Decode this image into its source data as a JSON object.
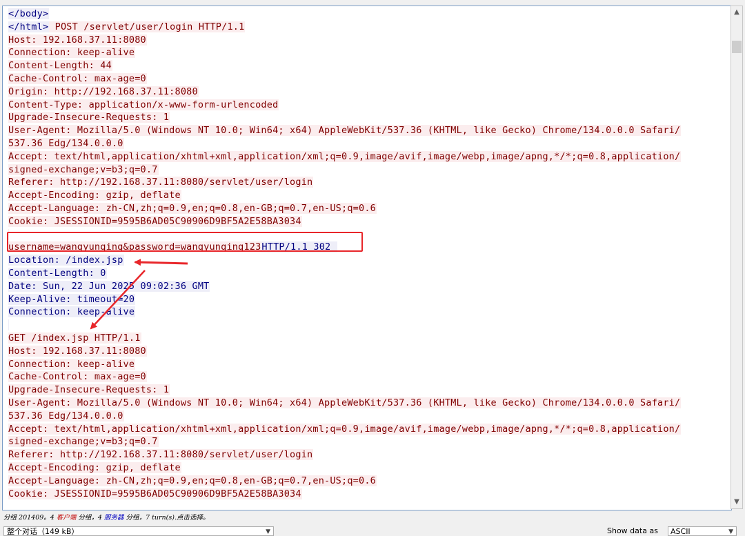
{
  "stream": {
    "lines": [
      {
        "text": "</body>",
        "side": "server"
      },
      {
        "text": "</html>",
        "side": "server",
        "tail": " POST /servlet/user/login HTTP/1.1",
        "tail_side": "client"
      },
      {
        "text": "Host: 192.168.37.11:8080",
        "side": "client"
      },
      {
        "text": "Connection: keep-alive",
        "side": "client"
      },
      {
        "text": "Content-Length: 44",
        "side": "client"
      },
      {
        "text": "Cache-Control: max-age=0",
        "side": "client"
      },
      {
        "text": "Origin: http://192.168.37.11:8080",
        "side": "client"
      },
      {
        "text": "Content-Type: application/x-www-form-urlencoded",
        "side": "client"
      },
      {
        "text": "Upgrade-Insecure-Requests: 1",
        "side": "client"
      },
      {
        "text": "User-Agent: Mozilla/5.0 (Windows NT 10.0; Win64; x64) AppleWebKit/537.36 (KHTML, like Gecko) Chrome/134.0.0.0 Safari/",
        "side": "client"
      },
      {
        "text": "537.36 Edg/134.0.0.0",
        "side": "client"
      },
      {
        "text": "Accept: text/html,application/xhtml+xml,application/xml;q=0.9,image/avif,image/webp,image/apng,*/*;q=0.8,application/",
        "side": "client"
      },
      {
        "text": "signed-exchange;v=b3;q=0.7",
        "side": "client"
      },
      {
        "text": "Referer: http://192.168.37.11:8080/servlet/user/login",
        "side": "client"
      },
      {
        "text": "Accept-Encoding: gzip, deflate",
        "side": "client"
      },
      {
        "text": "Accept-Language: zh-CN,zh;q=0.9,en;q=0.8,en-GB;q=0.7,en-US;q=0.6",
        "side": "client"
      },
      {
        "text": "Cookie: JSESSIONID=9595B6AD05C90906D9BF5A2E58BA3034",
        "side": "client"
      },
      {
        "text": "",
        "side": "client"
      },
      {
        "text": "username=wangyunqing&password=wangyunqing123",
        "side": "client",
        "tail": "HTTP/1.1 302 ",
        "tail_side": "server"
      },
      {
        "text": "Location: /index.jsp",
        "side": "server"
      },
      {
        "text": "Content-Length: 0",
        "side": "server"
      },
      {
        "text": "Date: Sun, 22 Jun 2025 09:02:36 GMT",
        "side": "server"
      },
      {
        "text": "Keep-Alive: timeout=20",
        "side": "server"
      },
      {
        "text": "Connection: keep-alive",
        "side": "server"
      },
      {
        "text": "",
        "side": "server"
      },
      {
        "text": "GET /index.jsp HTTP/1.1",
        "side": "client"
      },
      {
        "text": "Host: 192.168.37.11:8080",
        "side": "client"
      },
      {
        "text": "Connection: keep-alive",
        "side": "client"
      },
      {
        "text": "Cache-Control: max-age=0",
        "side": "client"
      },
      {
        "text": "Upgrade-Insecure-Requests: 1",
        "side": "client"
      },
      {
        "text": "User-Agent: Mozilla/5.0 (Windows NT 10.0; Win64; x64) AppleWebKit/537.36 (KHTML, like Gecko) Chrome/134.0.0.0 Safari/",
        "side": "client"
      },
      {
        "text": "537.36 Edg/134.0.0.0",
        "side": "client"
      },
      {
        "text": "Accept: text/html,application/xhtml+xml,application/xml;q=0.9,image/avif,image/webp,image/apng,*/*;q=0.8,application/",
        "side": "client"
      },
      {
        "text": "signed-exchange;v=b3;q=0.7",
        "side": "client"
      },
      {
        "text": "Referer: http://192.168.37.11:8080/servlet/user/login",
        "side": "client"
      },
      {
        "text": "Accept-Encoding: gzip, deflate",
        "side": "client"
      },
      {
        "text": "Accept-Language: zh-CN,zh;q=0.9,en;q=0.8,en-GB;q=0.7,en-US;q=0.6",
        "side": "client"
      },
      {
        "text": "Cookie: JSESSIONID=9595B6AD05C90906D9BF5A2E58BA3034",
        "side": "client"
      }
    ]
  },
  "status": {
    "prefix": "分组 201409。4 ",
    "client_label": "客户端",
    "middle": " 分组，4 ",
    "server_label": "服务器",
    "suffix": " 分组，7 turn(s).点击选择。"
  },
  "footer": {
    "conversation_value": "整个对话（149 kB）",
    "show_data_label": "Show data as",
    "format_value": "ASCII"
  },
  "colors": {
    "client_bg": "#fbedee",
    "client_fg": "#800000",
    "server_bg": "#eeeef8",
    "server_fg": "#000080",
    "annotation": "#e8262a"
  },
  "icons": {
    "scroll_up": "chevron-up-icon",
    "scroll_down": "chevron-down-icon",
    "dropdown": "chevron-down-icon"
  }
}
